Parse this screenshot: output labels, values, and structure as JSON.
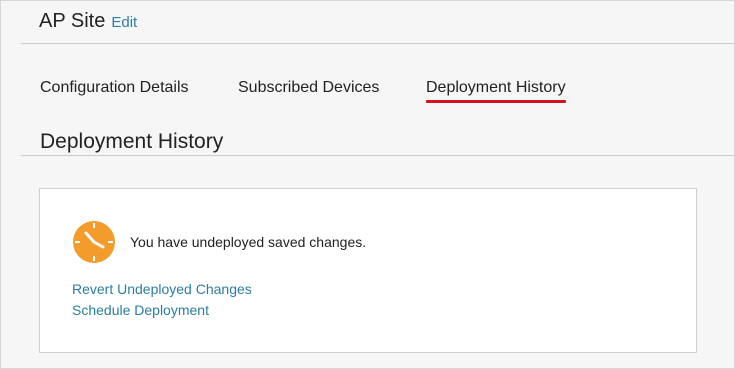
{
  "header": {
    "title": "AP Site",
    "edit_label": "Edit"
  },
  "tabs": [
    {
      "label": "Configuration Details",
      "active": false
    },
    {
      "label": "Subscribed Devices",
      "active": false
    },
    {
      "label": "Deployment History",
      "active": true
    }
  ],
  "section": {
    "title": "Deployment History"
  },
  "notice": {
    "icon": "clock-icon",
    "icon_color": "#f39c2c",
    "message": "You have undeployed saved changes.",
    "actions": [
      {
        "label": "Revert Undeployed Changes"
      },
      {
        "label": "Schedule Deployment"
      }
    ]
  },
  "colors": {
    "link": "#2a7fa0",
    "active_tab_underline": "#d4111c"
  }
}
